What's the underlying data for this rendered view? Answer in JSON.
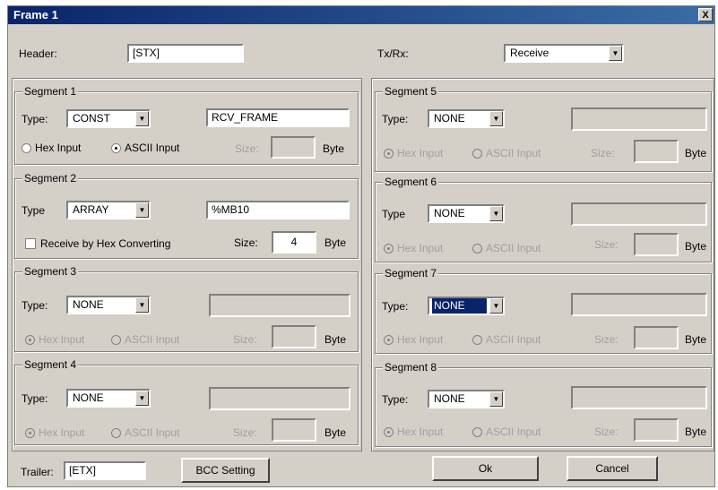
{
  "window": {
    "title": "Frame 1",
    "close_glyph": "X"
  },
  "header": {
    "label": "Header:",
    "value": "[STX]"
  },
  "txrx": {
    "label": "Tx/Rx:",
    "value": "Receive"
  },
  "common": {
    "type_label_colon": "Type:",
    "type_label": "Type",
    "size_label": "Size:",
    "byte_label": "Byte",
    "hex_input": "Hex Input",
    "ascii_input": "ASCII Input",
    "arrow": "▼"
  },
  "segments": [
    {
      "title": "Segment 1",
      "type": "CONST",
      "value": "RCV_FRAME",
      "size": ""
    },
    {
      "title": "Segment 2",
      "type": "ARRAY",
      "value": "%MB10",
      "size": "4",
      "checkbox_label": "Receive by Hex Converting"
    },
    {
      "title": "Segment 3",
      "type": "NONE",
      "value": "",
      "size": ""
    },
    {
      "title": "Segment 4",
      "type": "NONE",
      "value": "",
      "size": ""
    },
    {
      "title": "Segment 5",
      "type": "NONE",
      "value": "",
      "size": ""
    },
    {
      "title": "Segment 6",
      "type": "NONE",
      "value": "",
      "size": ""
    },
    {
      "title": "Segment 7",
      "type": "NONE",
      "value": "",
      "size": ""
    },
    {
      "title": "Segment 8",
      "type": "NONE",
      "value": "",
      "size": ""
    }
  ],
  "trailer": {
    "label": "Trailer:",
    "value": "[ETX]"
  },
  "buttons": {
    "bcc": "BCC Setting",
    "ok": "Ok",
    "cancel": "Cancel"
  }
}
